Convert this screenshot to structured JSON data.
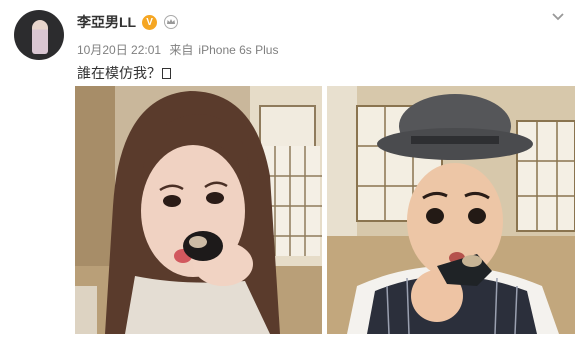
{
  "post": {
    "username": "李亞男LL",
    "verified_badge": "V",
    "timestamp": "10月20日 22:01",
    "source_prefix": "来自",
    "source_device": "iPhone 6s Plus",
    "text": "誰在模仿我？",
    "icons": [
      "avatar",
      "verified-badge-icon",
      "crown-icon",
      "chevron-down-icon"
    ],
    "images": [
      "selfie-woman-photo",
      "selfie-man-photo"
    ]
  },
  "colors": {
    "username": "#333333",
    "meta": "#808080",
    "verified": "#f5a623"
  }
}
